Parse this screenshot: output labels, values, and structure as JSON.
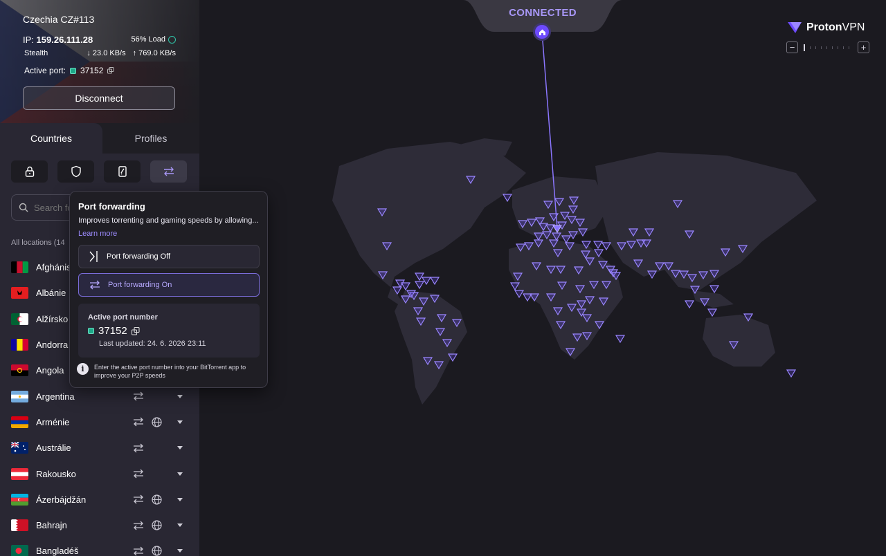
{
  "connection": {
    "server": "Czechia CZ#113",
    "ip_label": "IP:",
    "ip": "159.26.111.28",
    "load": "56% Load",
    "protocol": "Stealth",
    "download": "23.0 KB/s",
    "upload": "769.0 KB/s",
    "active_port_label": "Active port:",
    "active_port": "37152",
    "disconnect_label": "Disconnect"
  },
  "tabs": {
    "countries": "Countries",
    "profiles": "Profiles"
  },
  "search": {
    "placeholder": "Search fo"
  },
  "all_locations": "All locations (14",
  "countries": [
    {
      "name": "Afghánis",
      "flag": "af"
    },
    {
      "name": "Albánie",
      "flag": "al"
    },
    {
      "name": "Alžírsko",
      "flag": "dz"
    },
    {
      "name": "Andorra",
      "flag": "ad"
    },
    {
      "name": "Angola",
      "flag": "ao"
    },
    {
      "name": "Argentina",
      "flag": "ar",
      "p2p": true,
      "tor": false
    },
    {
      "name": "Arménie",
      "flag": "am",
      "p2p": true,
      "tor": true
    },
    {
      "name": "Austrálie",
      "flag": "au",
      "p2p": true,
      "tor": false
    },
    {
      "name": "Rakousko",
      "flag": "at",
      "p2p": true,
      "tor": false
    },
    {
      "name": "Ázerbájdžán",
      "flag": "az",
      "p2p": true,
      "tor": true
    },
    {
      "name": "Bahrajn",
      "flag": "bh",
      "p2p": true,
      "tor": true
    },
    {
      "name": "Bangladéš",
      "flag": "bd",
      "p2p": true,
      "tor": true
    }
  ],
  "map": {
    "status": "CONNECTED",
    "brand_a": "Proton",
    "brand_b": "VPN",
    "zoom_minus": "−",
    "zoom_plus": "+",
    "zoom_level": 0
  },
  "popover": {
    "title": "Port forwarding",
    "description": "Improves torrenting and gaming speeds by allowing...",
    "learn_more": "Learn more",
    "option_off": "Port forwarding Off",
    "option_on": "Port forwarding On",
    "port_label": "Active port number",
    "port": "37152",
    "updated": "Last updated: 24. 6. 2026 23:11",
    "info": "Enter the active port number into your BitTorrent app to improve your P2P speeds"
  },
  "colors": {
    "accent": "#6d4aff",
    "accent_text": "#a897f7",
    "green": "#1ea787"
  }
}
